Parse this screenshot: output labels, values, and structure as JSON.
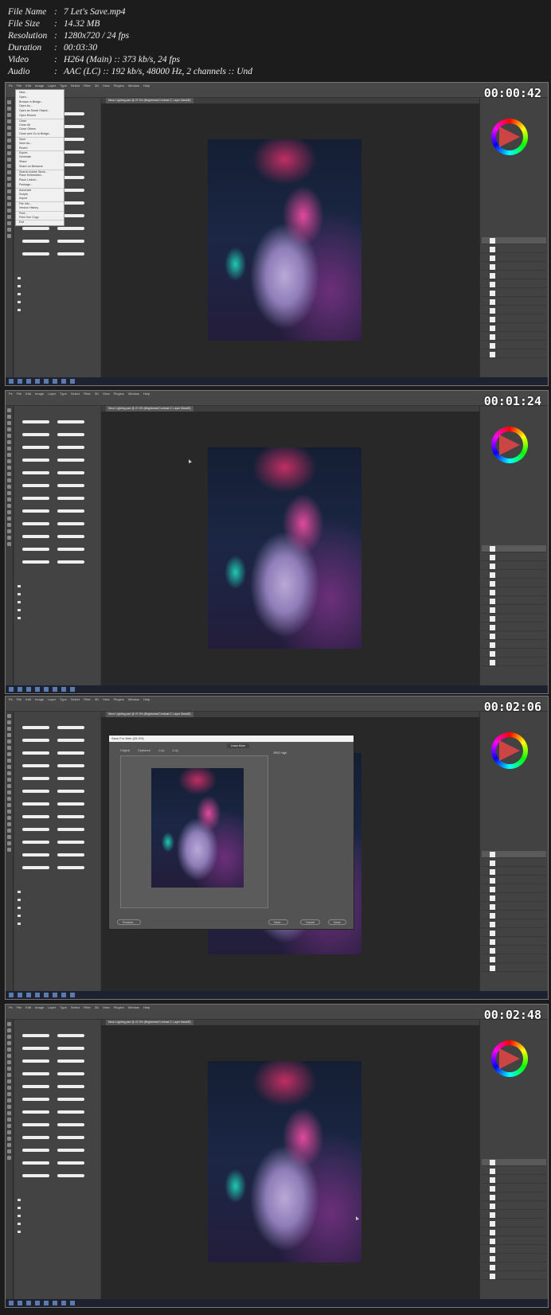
{
  "file_info": [
    {
      "key": "File Name",
      "value": "7 Let's Save.mp4"
    },
    {
      "key": "File Size",
      "value": "14.32 MB"
    },
    {
      "key": "Resolution",
      "value": "1280x720 / 24 fps"
    },
    {
      "key": "Duration",
      "value": "00:03:30"
    },
    {
      "key": "Video",
      "value": "H264 (Main) :: 373 kb/s, 24 fps"
    },
    {
      "key": "Audio",
      "value": "AAC (LC) :: 192 kb/s, 48000 Hz, 2 channels :: Und"
    }
  ],
  "menubar": [
    "Ps",
    "File",
    "Edit",
    "Image",
    "Layer",
    "Type",
    "Select",
    "Filter",
    "3D",
    "View",
    "Plugins",
    "Window",
    "Help"
  ],
  "file_menu": [
    "New...",
    "Open...",
    "Browse in Bridge...",
    "Open As...",
    "Open as Smart Object...",
    "Open Recent",
    "Close",
    "Close All",
    "Close Others",
    "Close and Go to Bridge...",
    "Save",
    "Save As...",
    "Revert",
    "Export",
    "Generate",
    "Share",
    "Share on Behance",
    "Search Adobe Stock...",
    "Place Embedded...",
    "Place Linked...",
    "Package...",
    "Automate",
    "Scripts",
    "Import",
    "File Info...",
    "Version History",
    "Print...",
    "Print One Copy",
    "Exit"
  ],
  "doc_tabs": [
    "Neon Lighting.psd @ 47.4% (Brightness/Contrast 2, Layer Mask/8)"
  ],
  "save_dialog": {
    "title": "Save For Web (33.3%)",
    "tabs": [
      "Original",
      "Optimized",
      "2-Up",
      "4-Up"
    ],
    "learn_more": "Learn More",
    "preset": "JPEG High",
    "buttons": {
      "preview": "Preview...",
      "save": "Save...",
      "cancel": "Cancel",
      "done": "Done"
    }
  },
  "frames": [
    {
      "timestamp": "00:00:42",
      "show_menu": true,
      "show_dialog": false
    },
    {
      "timestamp": "00:01:24",
      "show_menu": false,
      "show_dialog": false
    },
    {
      "timestamp": "00:02:06",
      "show_menu": false,
      "show_dialog": true
    },
    {
      "timestamp": "00:02:48",
      "show_menu": false,
      "show_dialog": false
    }
  ]
}
